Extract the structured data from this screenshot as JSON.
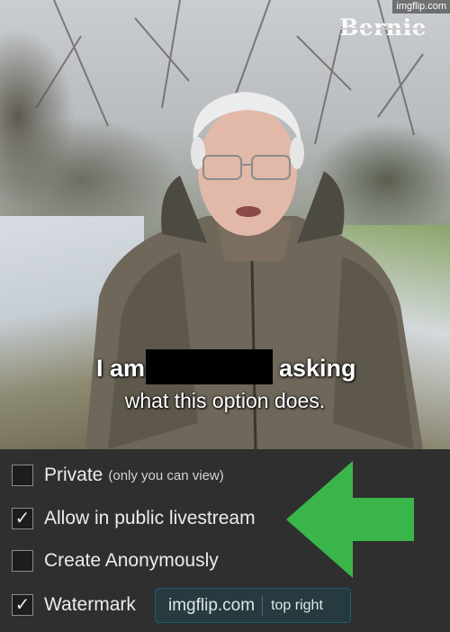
{
  "meme": {
    "watermark_corner": "imgflip.com",
    "logo": "Bernie",
    "line1_start": "I am",
    "line1_end": "asking",
    "line2": "what this option does."
  },
  "options": {
    "private": {
      "label": "Private",
      "sub": "(only you can view)",
      "checked": false
    },
    "public_livestream": {
      "label": "Allow in public livestream",
      "checked": true
    },
    "anonymous": {
      "label": "Create Anonymously",
      "checked": false
    },
    "watermark": {
      "label": "Watermark",
      "checked": true,
      "value": "imgflip.com",
      "position": "top right"
    }
  },
  "check_glyph": "✓",
  "colors": {
    "arrow": "#3ab54a",
    "panel_bg": "#2f2f2f",
    "watermark_border": "#1d5f73"
  }
}
